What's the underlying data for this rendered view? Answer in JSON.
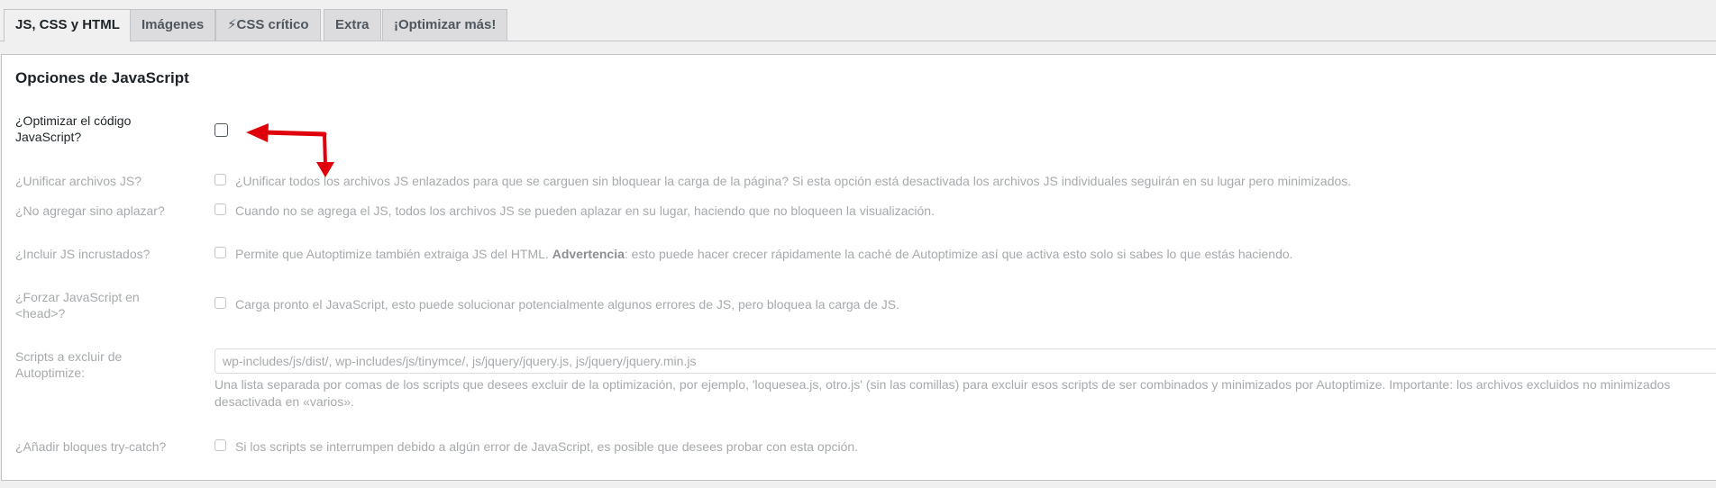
{
  "tabs": [
    {
      "label": "JS, CSS y HTML",
      "active": true
    },
    {
      "label": "Imágenes",
      "active": false
    },
    {
      "label": "⚡CSS crítico",
      "active": false
    },
    {
      "label": "Extra",
      "active": false
    },
    {
      "label": "¡Optimizar más!",
      "active": false
    }
  ],
  "section": {
    "title": "Opciones de JavaScript"
  },
  "options": {
    "optimize_js": {
      "label": "¿Optimizar el código JavaScript?",
      "checked": false
    },
    "aggregate_js": {
      "label": "¿Unificar archivos JS?",
      "description": "¿Unificar todos los archivos JS enlazados para que se carguen sin bloquear la carga de la página? Si esta opción está desactivada los archivos JS individuales seguirán en su lugar pero minimizados."
    },
    "defer_js": {
      "label": "¿No agregar sino aplazar?",
      "description": "Cuando no se agrega el JS, todos los archivos JS se pueden aplazar en su lugar, haciendo que no bloqueen la visualización."
    },
    "inline_js": {
      "label": "¿Incluir JS incrustados?",
      "description_pre": "Permite que Autoptimize también extraiga JS del HTML. ",
      "description_bold": "Advertencia",
      "description_post": ": esto puede hacer crecer rápidamente la caché de Autoptimize así que activa esto solo si sabes lo que estás haciendo."
    },
    "force_head": {
      "label": "¿Forzar JavaScript en <head>?",
      "description": "Carga pronto el JavaScript, esto puede solucionar potencialmente algunos errores de JS, pero bloquea la carga de JS."
    },
    "exclude_scripts": {
      "label": "Scripts a excluir de Autoptimize:",
      "value": "wp-includes/js/dist/, wp-includes/js/tinymce/, js/jquery/jquery.js, js/jquery/jquery.min.js",
      "help_line1": "Una lista separada por comas de los scripts que desees excluir de la optimización, por ejemplo, 'loquesea.js, otro.js' (sin las comillas) para excluir esos scripts de ser combinados y minimizados por Autoptimize. Importante: los archivos excluidos no minimizados",
      "help_line2": "desactivada en «varios»."
    },
    "try_catch": {
      "label": "¿Añadir bloques try-catch?",
      "description": "Si los scripts se interrumpen debido a algún error de JavaScript, es posible que desees probar con esta opción."
    }
  },
  "colors": {
    "annotation_arrow": "#e0000c",
    "disabled_text": "#a7aaad",
    "tab_inactive_bg": "#dcdcde"
  }
}
